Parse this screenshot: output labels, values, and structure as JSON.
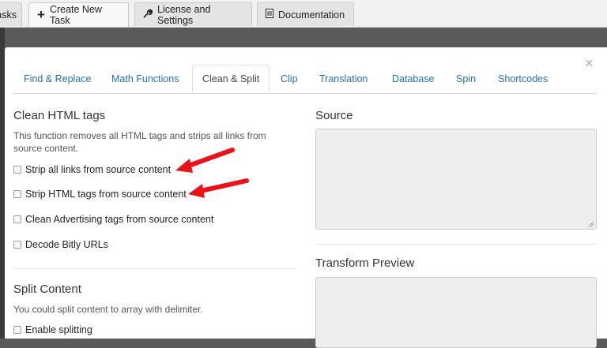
{
  "top_tabs": [
    {
      "label": "asks",
      "icon": ""
    },
    {
      "label": "Create New Task",
      "icon": "plus-icon"
    },
    {
      "label": "License and Settings",
      "icon": "wrench-icon"
    },
    {
      "label": "Documentation",
      "icon": "document-icon"
    }
  ],
  "modal": {
    "close_glyph": "×",
    "tabs": [
      "Find & Replace",
      "Math Functions",
      "Clean & Split",
      "Clip",
      "Translation",
      "Database",
      "Spin",
      "Shortcodes"
    ],
    "active_tab": "Clean & Split",
    "clean": {
      "title": "Clean HTML tags",
      "description": "This function removes all HTML tags and strips all links from source content.",
      "options": [
        "Strip all links from source content",
        "Strip HTML tags from source content",
        "Clean Advertising tags from source content",
        "Decode Bitly URLs"
      ]
    },
    "split": {
      "title": "Split Content",
      "description": "You could split content to array with delimiter.",
      "options": [
        "Enable splitting"
      ]
    },
    "source_label": "Source",
    "transform_label": "Transform Preview"
  },
  "colors": {
    "arrow": "#e8141a",
    "link": "#2a6fb0"
  }
}
